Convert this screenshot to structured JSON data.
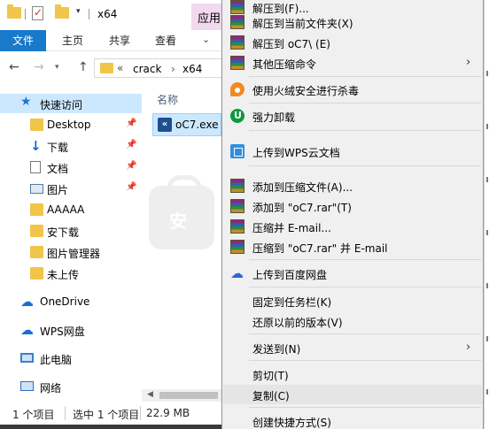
{
  "window": {
    "title": "x64",
    "app_tab_label": "应用",
    "qa_dropdown": "▾"
  },
  "ribbon": {
    "tabs": [
      "文件",
      "主页",
      "共享",
      "查看"
    ],
    "expand": "⌄"
  },
  "address": {
    "chevron": "«",
    "segments": [
      "crack",
      "x64"
    ],
    "separator": "›"
  },
  "sidebar": {
    "quick_access": "快速访问",
    "items": [
      {
        "label": "Desktop",
        "icon": "folder-icon",
        "pinned": true
      },
      {
        "label": "下载",
        "icon": "download-arrow-icon",
        "pinned": true
      },
      {
        "label": "文档",
        "icon": "document-icon",
        "pinned": true
      },
      {
        "label": "图片",
        "icon": "picture-icon",
        "pinned": true
      },
      {
        "label": "AAAAA",
        "icon": "folder-icon",
        "pinned": false
      },
      {
        "label": "安下载",
        "icon": "folder-icon",
        "pinned": false
      },
      {
        "label": "图片管理器",
        "icon": "folder-icon",
        "pinned": false
      },
      {
        "label": "未上传",
        "icon": "folder-icon",
        "pinned": false
      }
    ],
    "onedrive": "OneDrive",
    "wps": "WPS网盘",
    "this_pc": "此电脑",
    "network": "网络",
    "pin_glyph": "📌"
  },
  "file_list": {
    "column_name": "名称",
    "selected_file": "oC7.exe",
    "file_icon_glyph": "«"
  },
  "status": {
    "item_count": "1 个项目",
    "selected": "选中 1 个项目",
    "size": "22.9 MB"
  },
  "watermark": {
    "glyph": "安"
  },
  "context_menu": {
    "items": [
      {
        "label": "解压到(F)...",
        "icon": "winrar-icon"
      },
      {
        "label": "解压到当前文件夹(X)",
        "icon": "winrar-icon"
      },
      {
        "label": "解压到 oC7\\ (E)",
        "icon": "winrar-icon"
      },
      {
        "label": "其他压缩命令",
        "icon": "winrar-icon",
        "submenu": true
      },
      {
        "label": "使用火绒安全进行杀毒",
        "icon": "huorong-icon"
      },
      {
        "label": "强力卸载",
        "icon": "uninstall-icon"
      },
      {
        "label": "上传到WPS云文档",
        "icon": "wps-cloud-icon"
      },
      {
        "label": "添加到压缩文件(A)...",
        "icon": "winrar-icon"
      },
      {
        "label": "添加到 \"oC7.rar\"(T)",
        "icon": "winrar-icon"
      },
      {
        "label": "压缩并 E-mail...",
        "icon": "winrar-icon"
      },
      {
        "label": "压缩到 \"oC7.rar\" 并 E-mail",
        "icon": "winrar-icon"
      },
      {
        "label": "上传到百度网盘",
        "icon": "baidu-netdisk-icon"
      },
      {
        "label": "固定到任务栏(K)"
      },
      {
        "label": "还原以前的版本(V)"
      },
      {
        "label": "发送到(N)",
        "submenu": true
      },
      {
        "label": "剪切(T)"
      },
      {
        "label": "复制(C)",
        "highlighted": true
      },
      {
        "label": "创建快捷方式(S)"
      }
    ],
    "arrow_glyph": "›"
  }
}
